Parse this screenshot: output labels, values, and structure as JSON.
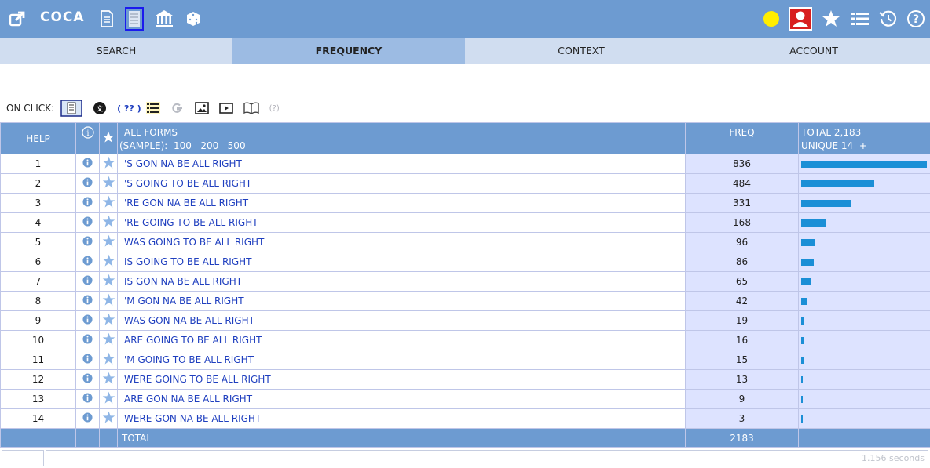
{
  "app": {
    "title": "COCA",
    "icons": [
      "external-link-icon",
      "document-icon",
      "notebook-icon",
      "bank-icon",
      "dice-icon",
      "status-dot-icon",
      "user-icon",
      "star-icon",
      "list-icon",
      "history-icon",
      "help-icon"
    ],
    "status_dot_color": "#ffee00",
    "accent": "#6d9bd1"
  },
  "tabs": [
    {
      "label": "SEARCH"
    },
    {
      "label": "FREQUENCY"
    },
    {
      "label": "CONTEXT"
    },
    {
      "label": "ACCOUNT"
    }
  ],
  "on_click": {
    "label": "ON CLICK:",
    "translate_label": "( ?? )",
    "help_label": "(?)"
  },
  "table": {
    "headers": {
      "help": "HELP",
      "all_forms": "ALL FORMS",
      "sample_prefix": "(SAMPLE):",
      "sample_100": "100",
      "sample_200": "200",
      "sample_500": "500",
      "freq": "FREQ",
      "total": "TOTAL 2,183",
      "unique": "UNIQUE 14",
      "plus": "+"
    },
    "max_freq": 836,
    "rows": [
      {
        "n": "1",
        "form": "'S GON NA BE ALL RIGHT",
        "freq": "836"
      },
      {
        "n": "2",
        "form": "'S GOING TO BE ALL RIGHT",
        "freq": "484"
      },
      {
        "n": "3",
        "form": "'RE GON NA BE ALL RIGHT",
        "freq": "331"
      },
      {
        "n": "4",
        "form": "'RE GOING TO BE ALL RIGHT",
        "freq": "168"
      },
      {
        "n": "5",
        "form": "WAS GOING TO BE ALL RIGHT",
        "freq": "96"
      },
      {
        "n": "6",
        "form": "IS GOING TO BE ALL RIGHT",
        "freq": "86"
      },
      {
        "n": "7",
        "form": "IS GON NA BE ALL RIGHT",
        "freq": "65"
      },
      {
        "n": "8",
        "form": "'M GON NA BE ALL RIGHT",
        "freq": "42"
      },
      {
        "n": "9",
        "form": "WAS GON NA BE ALL RIGHT",
        "freq": "19"
      },
      {
        "n": "10",
        "form": "ARE GOING TO BE ALL RIGHT",
        "freq": "16"
      },
      {
        "n": "11",
        "form": "'M GOING TO BE ALL RIGHT",
        "freq": "15"
      },
      {
        "n": "12",
        "form": "WERE GOING TO BE ALL RIGHT",
        "freq": "13"
      },
      {
        "n": "13",
        "form": "ARE GON NA BE ALL RIGHT",
        "freq": "9"
      },
      {
        "n": "14",
        "form": "WERE GON NA BE ALL RIGHT",
        "freq": "3"
      }
    ],
    "footer": {
      "label": "TOTAL",
      "value": "2183"
    }
  },
  "status": {
    "timing": "1.156 seconds"
  }
}
